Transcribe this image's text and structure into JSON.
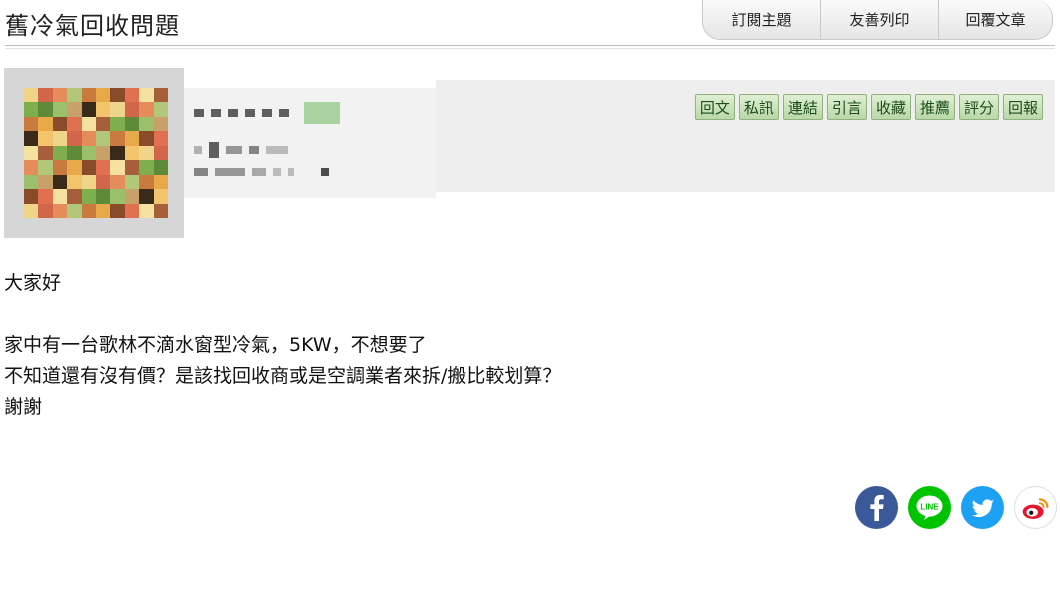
{
  "header": {
    "title": "舊冷氣回收問題"
  },
  "tabs": [
    {
      "label": "訂閱主題"
    },
    {
      "label": "友善列印"
    },
    {
      "label": "回覆文章"
    }
  ],
  "actions": [
    {
      "label": "回文"
    },
    {
      "label": "私訊"
    },
    {
      "label": "連結"
    },
    {
      "label": "引言"
    },
    {
      "label": "收藏"
    },
    {
      "label": "推薦"
    },
    {
      "label": "評分"
    },
    {
      "label": "回報"
    }
  ],
  "post": {
    "lines": [
      "大家好",
      "家中有一台歌林不滴水窗型冷氣，5KW，不想要了",
      "不知道還有沒有價？是該找回收商或是空調業者來拆/搬比較划算？",
      "謝謝"
    ]
  },
  "share": [
    {
      "icon": "facebook-icon",
      "color": "#3b5998"
    },
    {
      "icon": "line-icon",
      "color": "#00c300"
    },
    {
      "icon": "twitter-icon",
      "color": "#1da1f2"
    },
    {
      "icon": "weibo-icon",
      "color": "#e6162d"
    }
  ],
  "colors": {
    "avatar_palette": [
      "#c97b3f",
      "#e8a94a",
      "#7fae4e",
      "#b3c77a",
      "#f0d48a",
      "#d1664a",
      "#8a4b2a",
      "#f3c46b",
      "#9bbf6a",
      "#c8a06a",
      "#e58d5a",
      "#5f8a3a",
      "#f6e2a0",
      "#a65f3a",
      "#3a2a1a",
      "#e07050"
    ]
  }
}
